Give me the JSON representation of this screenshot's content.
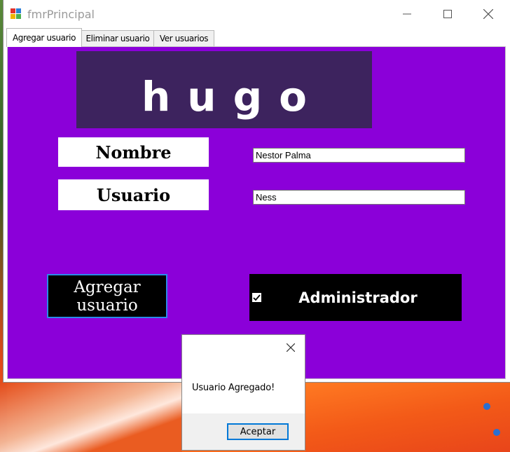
{
  "window": {
    "title": "fmrPrincipal",
    "controls": [
      "minimize-icon",
      "maximize-icon",
      "close-icon"
    ]
  },
  "tabs": [
    {
      "label": "Agregar usuario",
      "active": true
    },
    {
      "label": "Eliminar usuario",
      "active": false
    },
    {
      "label": "Ver usuarios",
      "active": false
    }
  ],
  "form": {
    "banner_text": "hugo",
    "nombre_label": "Nombre",
    "nombre_value": "Nestor Palma",
    "usuario_label": "Usuario",
    "usuario_value": "Ness",
    "add_button_label": "Agregar usuario",
    "admin_label": "Administrador",
    "admin_checked": true
  },
  "colors": {
    "panel_bg": "#8b00d9",
    "banner_bg": "#3d235e",
    "button_bg": "#000000",
    "focus_border": "#2a8ae8"
  },
  "dialog": {
    "message": "Usuario Agregado!",
    "ok_label": "Aceptar"
  }
}
